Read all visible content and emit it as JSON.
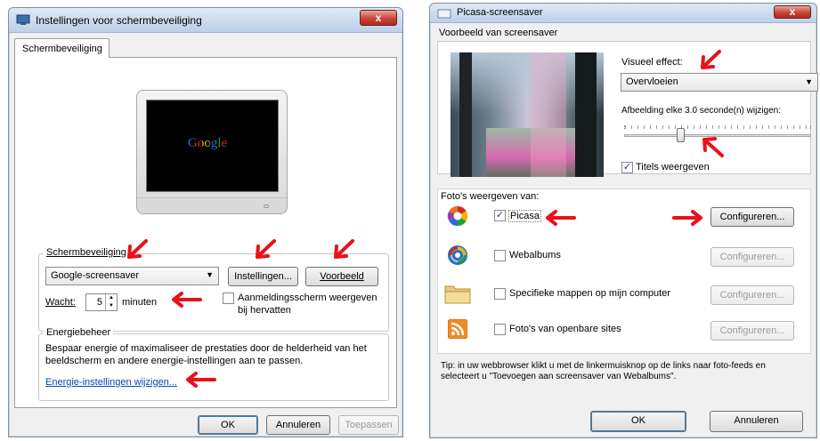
{
  "left_window": {
    "title": "Instellingen voor schermbeveiliging",
    "close": "x",
    "tab": "Schermbeveiliging",
    "preview_logo": "Google",
    "screensaver_group": "Schermbeveiliging",
    "screensaver_select": "Google-screensaver",
    "settings_button": "Instellingen...",
    "preview_button": "Voorbeeld",
    "wait_label": "Wacht:",
    "wait_value": "5",
    "minutes_label": "minuten",
    "logon_checkbox_label": "Aanmeldingsscherm weergeven bij hervatten",
    "energy_group": "Energiebeheer",
    "energy_text": "Bespaar energie of maximaliseer de prestaties door de helderheid van het beeldscherm en andere energie-instellingen aan te passen.",
    "energy_link": "Energie-instellingen wijzigen...",
    "ok_button": "OK",
    "cancel_button": "Annuleren",
    "apply_button": "Toepassen"
  },
  "right_window": {
    "title": "Picasa-screensaver",
    "close": "x",
    "preview_section": "Voorbeeld van screensaver",
    "visual_effect_label": "Visueel effect:",
    "visual_effect_value": "Overvloeien",
    "change_interval_label": "Afbeelding elke 3.0 seconde(n) wijzigen:",
    "slider_value": 0.3,
    "show_titles_label": "Titels weergeven",
    "show_titles_checked": true,
    "sources_label": "Foto's weergeven van:",
    "sources": [
      {
        "label": "Picasa",
        "checked": true,
        "icon": "picasa-icon",
        "configure": "Configureren...",
        "enabled": true
      },
      {
        "label": "Webalbums",
        "checked": false,
        "icon": "web-albums-icon",
        "configure": "Configureren...",
        "enabled": false
      },
      {
        "label": "Specifieke mappen op mijn computer",
        "checked": false,
        "icon": "folder-icon",
        "configure": "Configureren...",
        "enabled": false
      },
      {
        "label": "Foto's van openbare sites",
        "checked": false,
        "icon": "rss-icon",
        "configure": "Configureren...",
        "enabled": false
      }
    ],
    "tip": "Tip: in uw webbrowser klikt u met de linkermuisknop op de links naar foto-feeds en selecteert u \"Toevoegen aan screensaver van Webalbums\".",
    "ok_button": "OK",
    "cancel_button": "Annuleren"
  },
  "colors": {
    "arrow": "#e8121a",
    "link": "#0645ad",
    "titlebar": "#bcd0e8"
  }
}
